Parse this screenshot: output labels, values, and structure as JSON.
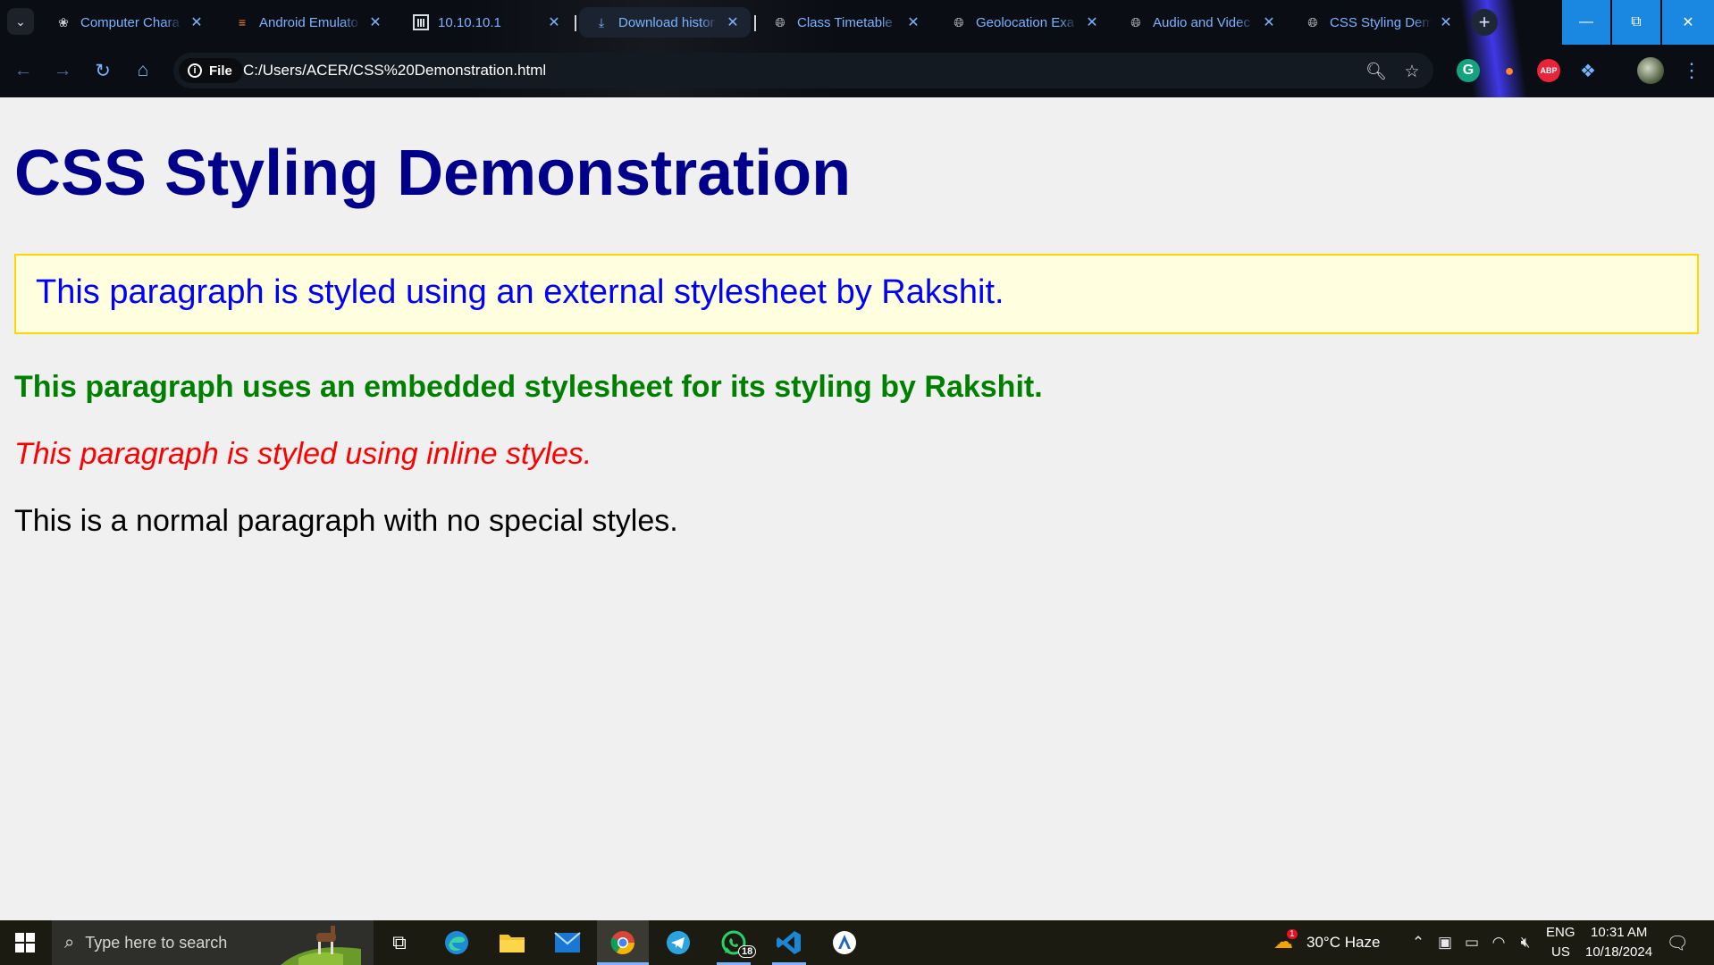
{
  "browser": {
    "tabs": [
      {
        "title": "Computer Chara",
        "favicon": "openai-icon"
      },
      {
        "title": "Android Emulato",
        "favicon": "stackoverflow-icon"
      },
      {
        "title": "10.10.10.1",
        "favicon": "router-icon"
      },
      {
        "title": "Download histor",
        "favicon": "download-icon"
      },
      {
        "title": "Class Timetable",
        "favicon": "globe-icon"
      },
      {
        "title": "Geolocation Exa",
        "favicon": "globe-icon"
      },
      {
        "title": "Audio and Videc",
        "favicon": "globe-icon"
      },
      {
        "title": "CSS Styling Dem",
        "favicon": "globe-icon"
      }
    ],
    "address": {
      "scheme_label": "File",
      "url": "C:/Users/ACER/CSS%20Demonstration.html"
    },
    "extensions": {
      "abp_label": "ABP",
      "grammarly_label": "G"
    },
    "accent_color": "#7ab3ff"
  },
  "page": {
    "title": "CSS Styling Demonstration",
    "external_paragraph": "This paragraph is styled using an external stylesheet by Rakshit.",
    "embedded_paragraph": "This paragraph uses an embedded stylesheet for its styling by Rakshit.",
    "inline_paragraph": "This paragraph is styled using inline styles.",
    "normal_paragraph": "This is a normal paragraph with no special styles.",
    "colors": {
      "title": "#00008b",
      "external_text": "#0000ff",
      "external_bg": "#ffffe0",
      "external_border": "#ffd700",
      "embedded_text": "#008000",
      "inline_text": "#ff0000",
      "background": "#f0f0f0"
    }
  },
  "taskbar": {
    "search_placeholder": "Type here to search",
    "whatsapp_badge": "18",
    "weather": {
      "badge": "1",
      "text": "30°C  Haze"
    },
    "language": {
      "line1": "ENG",
      "line2": "US"
    },
    "clock": {
      "time": "10:31 AM",
      "date": "10/18/2024"
    }
  }
}
